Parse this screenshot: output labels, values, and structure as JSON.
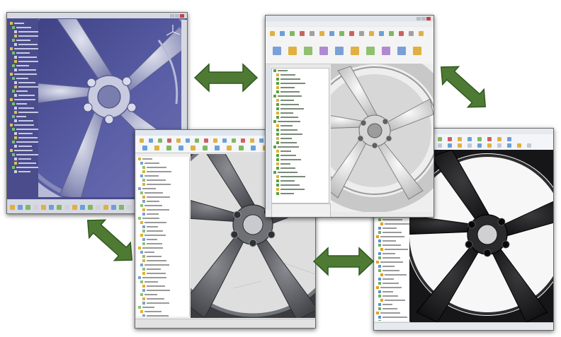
{
  "windows": {
    "catia": {
      "title": "",
      "menu": [],
      "status": "",
      "tree_items": 36,
      "colors": {
        "bg": "#4a4c8c",
        "tree_bg": "#5b5e9c",
        "chrome": "#d6d9e2"
      }
    },
    "topcenter": {
      "title": "",
      "menu": [
        "",
        "",
        "",
        "",
        "",
        "",
        "",
        ""
      ],
      "status": "",
      "tree_items": 30,
      "colors": {
        "chrome": "#e9e9e9",
        "ribbon": "#f4f4f4",
        "tree_bg": "#ffffff",
        "render_bg": "#eeeeee"
      }
    },
    "nx": {
      "title": "",
      "menu": [],
      "status": "",
      "tree_items": 40,
      "colors": {
        "chrome": "#eeeeee",
        "tree_bg": "#ffffff",
        "render_bg": "#d8d8d8"
      }
    },
    "solidworks": {
      "title": "",
      "menu": [],
      "status": "",
      "tree_items": 28,
      "colors": {
        "chrome": "#eef0f3",
        "tree_bg": "#ffffff",
        "render_bg": "#f7f7f7"
      }
    }
  },
  "arrows": {
    "color": "#4e7a34",
    "border": "#2e5a1e",
    "count": 4
  }
}
